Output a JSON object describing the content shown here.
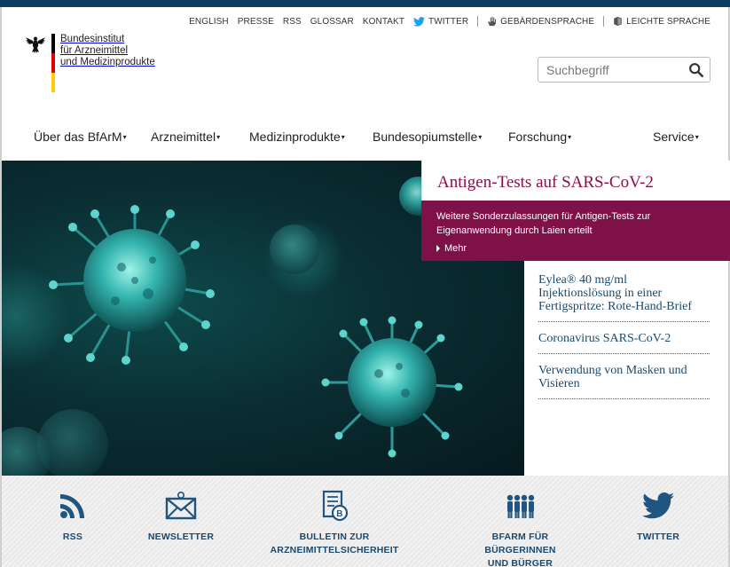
{
  "meta_links": {
    "english": "ENGLISH",
    "presse": "PRESSE",
    "rss": "RSS",
    "glossar": "GLOSSAR",
    "kontakt": "KONTAKT",
    "twitter": "TWITTER",
    "gebaerdensprache": "GEBÄRDENSPRACHE",
    "leichte_sprache": "LEICHTE SPRACHE"
  },
  "logo": {
    "line1": "Bundesinstitut",
    "line2": "für Arzneimittel",
    "line3": "und Medizinprodukte"
  },
  "search": {
    "placeholder": "Suchbegriff",
    "icon": "magnifier-icon"
  },
  "nav": {
    "ueber": "Über das BfArM",
    "arzneimittel": "Arzneimittel",
    "medizinprodukte": "Medizinprodukte",
    "bundesopiumstelle": "Bundesopiumstelle",
    "forschung": "Forschung",
    "service": "Service",
    "caret": "▾"
  },
  "feature": {
    "title": "Antigen-Tests auf SARS-CoV-2",
    "text": "Weitere Sonderzulassungen für Antigen-Tests zur Eigenanwendung durch Laien erteilt",
    "more": "Mehr"
  },
  "teasers": [
    "Eylea® 40 mg/ml Injektionslösung in einer Fertigspritze: Rote-Hand-Brief",
    "Coronavirus SARS-CoV-2",
    "Verwendung von Masken und Visieren"
  ],
  "band": {
    "rss": "RSS",
    "newsletter": "NEWSLETTER",
    "bulletin_line1": "BULLETIN ZUR",
    "bulletin_line2": "ARZNEIMITTELSICHERHEIT",
    "buerger_line1": "BFARM FÜR BÜRGERINNEN",
    "buerger_line2": "UND BÜRGER",
    "twitter": "TWITTER"
  },
  "colors": {
    "header_bar": "#0c3c64",
    "feature_red": "#7e1147",
    "link_blue": "#1a4a6e",
    "icon_blue": "#1f5580"
  }
}
